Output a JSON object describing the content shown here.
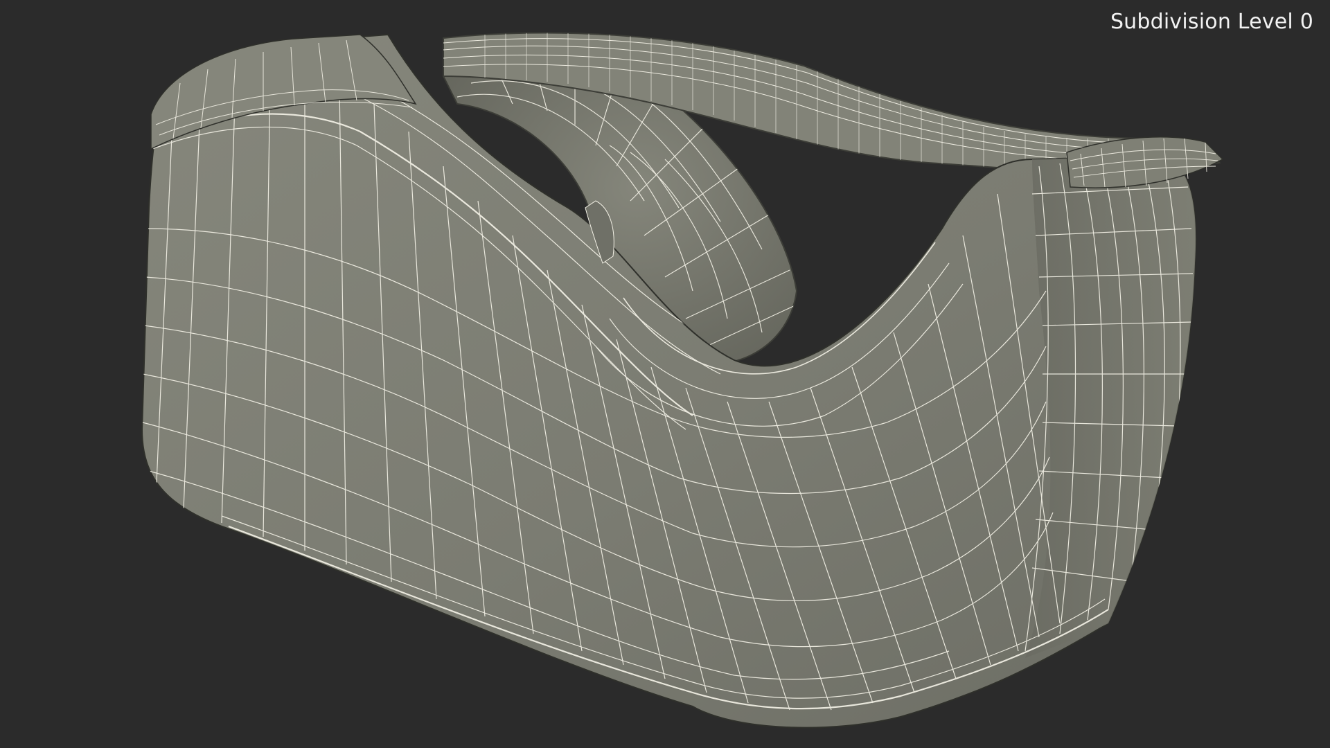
{
  "viewport": {
    "background_color": "#2b2b2b",
    "overlay_label": "Subdivision Level 0"
  },
  "model": {
    "surface_color": "#7b7c72",
    "shadow_color": "#56574f",
    "highlight_color": "#8a8b80",
    "wire_color": "#f3f1e6"
  }
}
